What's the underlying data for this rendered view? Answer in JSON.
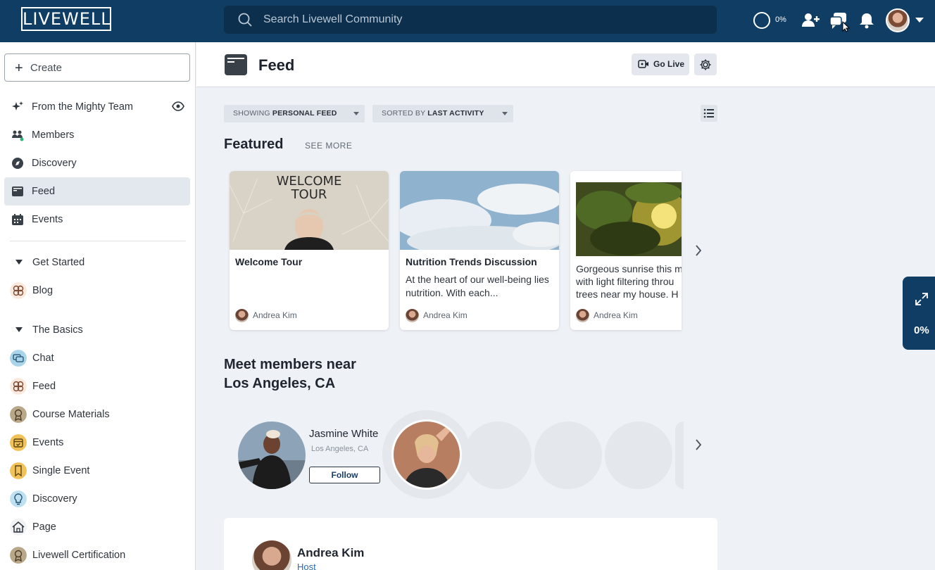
{
  "topbar": {
    "logo": "LIVEWELL",
    "search_placeholder": "Search Livewell Community",
    "progress": "0%"
  },
  "sidebar": {
    "create_label": "Create",
    "nav": [
      {
        "label": "From the Mighty Team",
        "icon": "sparkle-icon"
      },
      {
        "label": "Members",
        "icon": "members-icon"
      },
      {
        "label": "Discovery",
        "icon": "compass-icon"
      },
      {
        "label": "Feed",
        "icon": "feed-icon",
        "active": true
      },
      {
        "label": "Events",
        "icon": "calendar-icon"
      }
    ],
    "sections": [
      {
        "label": "Get Started",
        "items": [
          {
            "label": "Blog",
            "icon": "flower-icon"
          }
        ]
      },
      {
        "label": "The Basics",
        "items": [
          {
            "label": "Chat",
            "icon": "chat-bubble-icon"
          },
          {
            "label": "Feed",
            "icon": "flower-icon"
          },
          {
            "label": "Course Materials",
            "icon": "award-icon"
          },
          {
            "label": "Events",
            "icon": "calendar-check-icon"
          },
          {
            "label": "Single Event",
            "icon": "bookmark-icon"
          },
          {
            "label": "Discovery",
            "icon": "lightbulb-icon"
          },
          {
            "label": "Page",
            "icon": "house-icon"
          },
          {
            "label": "Livewell Certification",
            "icon": "award-icon"
          }
        ]
      }
    ]
  },
  "header": {
    "title": "Feed",
    "go_live": "Go Live"
  },
  "filters": {
    "showing_prefix": "SHOWING",
    "showing_value": "PERSONAL FEED",
    "sorted_prefix": "SORTED BY",
    "sorted_value": "LAST ACTIVITY"
  },
  "featured": {
    "heading": "Featured",
    "see_more": "SEE MORE",
    "cards": [
      {
        "image_text_1": "WELCOME",
        "image_text_2": "TOUR",
        "title": "Welcome Tour",
        "description": "",
        "author": "Andrea Kim"
      },
      {
        "title": "Nutrition Trends Discussion",
        "description": "At the heart of our well-being lies nutrition. With each...",
        "author": "Andrea Kim"
      },
      {
        "line1": "Gorgeous sunrise this m",
        "line2": "with light filtering throu",
        "line3": "trees near my house. H",
        "author": "Andrea Kim"
      }
    ]
  },
  "members": {
    "heading_line1": "Meet members near",
    "heading_line2": "Los Angeles, CA",
    "first": {
      "name": "Jasmine White",
      "location": "Los Angeles, CA",
      "follow": "Follow"
    }
  },
  "post": {
    "author": "Andrea Kim",
    "role": "Host"
  },
  "side_widget": {
    "progress": "0%"
  },
  "colors": {
    "topbar": "#0f3d63",
    "search_bg": "#0b2f4c",
    "active_nav": "#e3e8ef",
    "link": "#2a6cb0"
  }
}
